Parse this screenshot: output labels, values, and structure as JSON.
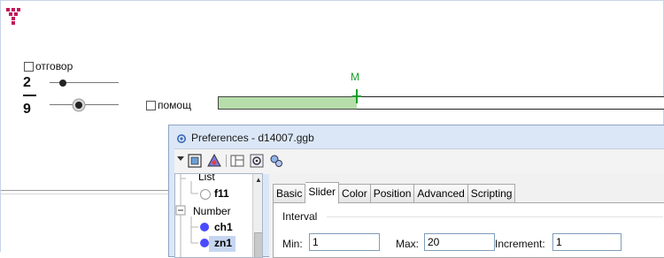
{
  "app": {
    "logo_icon": "geogebra-tower-icon",
    "accent_color": "#c2185b"
  },
  "graphics": {
    "answer_checkbox": {
      "label": "отговор",
      "checked": false
    },
    "help_checkbox": {
      "label": "помощ",
      "checked": false
    },
    "fraction": {
      "numerator": "2",
      "denominator": "9"
    },
    "slider_numerator": {
      "value": 2,
      "min": 1,
      "max": 20,
      "fraction": 0.2
    },
    "slider_denominator": {
      "value": 9,
      "min": 1,
      "max": 20,
      "fraction": 0.45
    },
    "bar": {
      "point_label": "M",
      "filled_fraction": 0.31,
      "fill_color": "#b6deaa",
      "point_color": "#1a9d2a"
    }
  },
  "dialog": {
    "title": "Preferences - d14007.ggb",
    "title_icon": "gear-icon",
    "toolbar_icons": [
      "dropdown-arrow-icon",
      "graphics-icon",
      "algebra-triangle-icon",
      "layout-icon",
      "settings-gear-icon",
      "advanced-gears-icon"
    ],
    "tree": {
      "items": [
        {
          "label": "List",
          "type": "group"
        },
        {
          "label": "f11",
          "type": "object",
          "color": "#ffffff"
        },
        {
          "label": "Number",
          "type": "group"
        },
        {
          "label": "ch1",
          "type": "object",
          "color": "#4a4aff"
        },
        {
          "label": "zn1",
          "type": "object",
          "color": "#4a4aff",
          "selected": true
        }
      ]
    },
    "tabs": [
      {
        "label": "Basic",
        "active": false
      },
      {
        "label": "Slider",
        "active": true
      },
      {
        "label": "Color",
        "active": false
      },
      {
        "label": "Position",
        "active": false
      },
      {
        "label": "Advanced",
        "active": false
      },
      {
        "label": "Scripting",
        "active": false
      }
    ],
    "interval": {
      "section_label": "Interval",
      "min_label": "Min:",
      "min_value": "1",
      "max_label": "Max:",
      "max_value": "20",
      "increment_label": "Increment:",
      "increment_value": "1"
    }
  }
}
